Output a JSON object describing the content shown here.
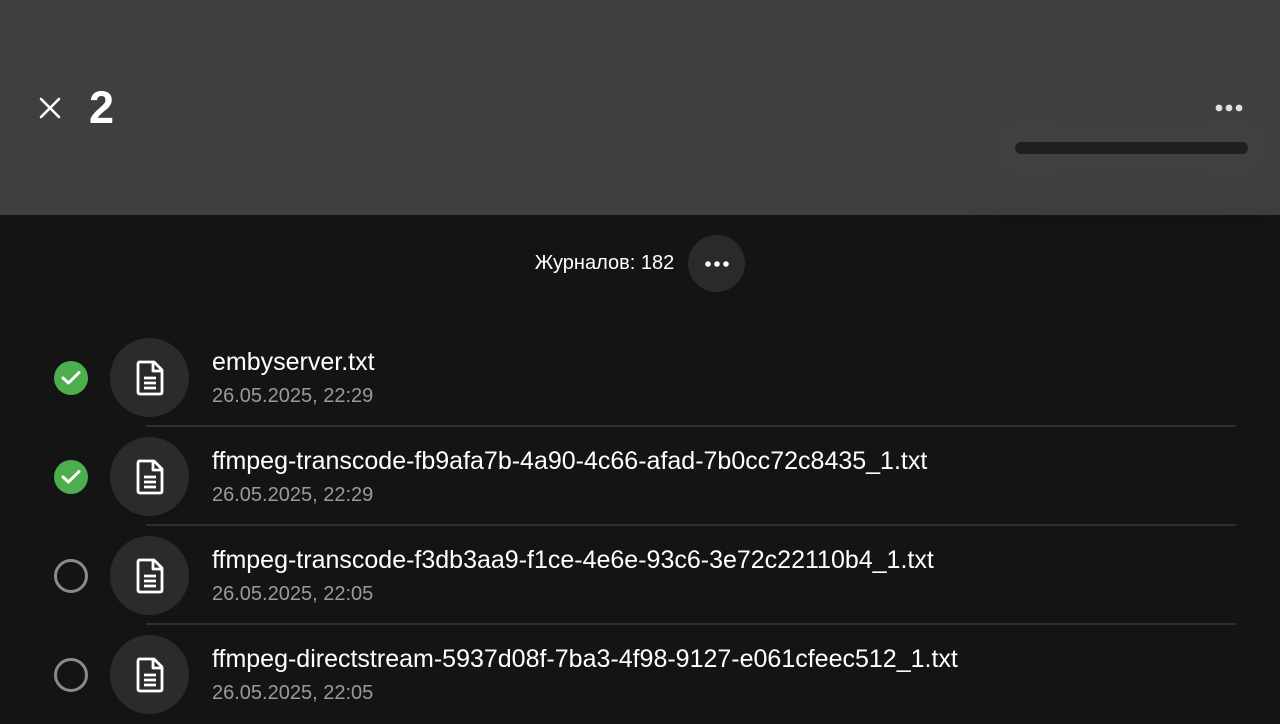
{
  "header": {
    "selected_count": "2",
    "close_icon": "close-icon",
    "more_icon": "more-horizontal-icon",
    "background": "#3f3f3f"
  },
  "summary": {
    "label": "Журналов: 182",
    "more_icon": "more-horizontal-icon"
  },
  "colors": {
    "background": "#141414",
    "check_green": "#4cae4c",
    "secondary_text": "#9a9a9a"
  },
  "files": [
    {
      "name": "embyserver.txt",
      "date": "26.05.2025, 22:29",
      "selected": true
    },
    {
      "name": "ffmpeg-transcode-fb9afa7b-4a90-4c66-afad-7b0cc72c8435_1.txt",
      "date": "26.05.2025, 22:29",
      "selected": true
    },
    {
      "name": "ffmpeg-transcode-f3db3aa9-f1ce-4e6e-93c6-3e72c22110b4_1.txt",
      "date": "26.05.2025, 22:05",
      "selected": false
    },
    {
      "name": "ffmpeg-directstream-5937d08f-7ba3-4f98-9127-e061cfeec512_1.txt",
      "date": "26.05.2025, 22:05",
      "selected": false
    }
  ]
}
